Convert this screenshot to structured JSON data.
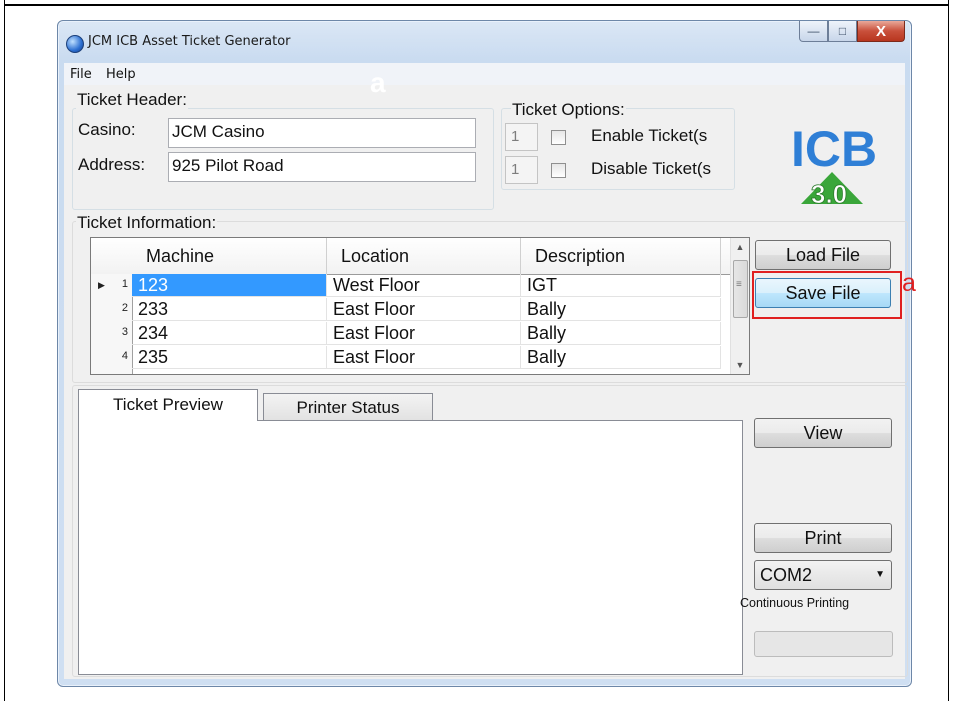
{
  "window": {
    "title": "JCM ICB Asset Ticket Generator"
  },
  "menu": {
    "items": [
      "File",
      "Help"
    ]
  },
  "annotations": {
    "marker_top": "a",
    "marker_right": "a"
  },
  "logo": {
    "line1": "ICB",
    "line2": "3.0"
  },
  "ticket_header": {
    "label": "Ticket Header:",
    "casino_label": "Casino:",
    "casino_value": "JCM Casino",
    "address_label": "Address:",
    "address_value": "925 Pilot Road"
  },
  "ticket_options": {
    "label": "Ticket Options:",
    "enable_count": "1",
    "enable_label": "Enable Ticket(s",
    "disable_count": "1",
    "disable_label": "Disable Ticket(s"
  },
  "ticket_info": {
    "label": "Ticket Information:",
    "columns": [
      "Machine",
      "Location",
      "Description"
    ],
    "rows": [
      {
        "num": "1",
        "machine": "123",
        "location": "West Floor",
        "description": "IGT"
      },
      {
        "num": "2",
        "machine": "233",
        "location": "East Floor",
        "description": "Bally"
      },
      {
        "num": "3",
        "machine": "234",
        "location": "East Floor",
        "description": "Bally"
      },
      {
        "num": "4",
        "machine": "235",
        "location": "East Floor",
        "description": "Bally"
      }
    ]
  },
  "buttons": {
    "load_file": "Load File",
    "save_file": "Save File",
    "view": "View",
    "print": "Print"
  },
  "tabs": {
    "preview": "Ticket Preview",
    "status": "Printer Status"
  },
  "port": {
    "selected": "COM2"
  },
  "continuous_printing": "Continuous Printing",
  "colors": {
    "selection": "#3399ff",
    "annotation": "#e02020"
  }
}
